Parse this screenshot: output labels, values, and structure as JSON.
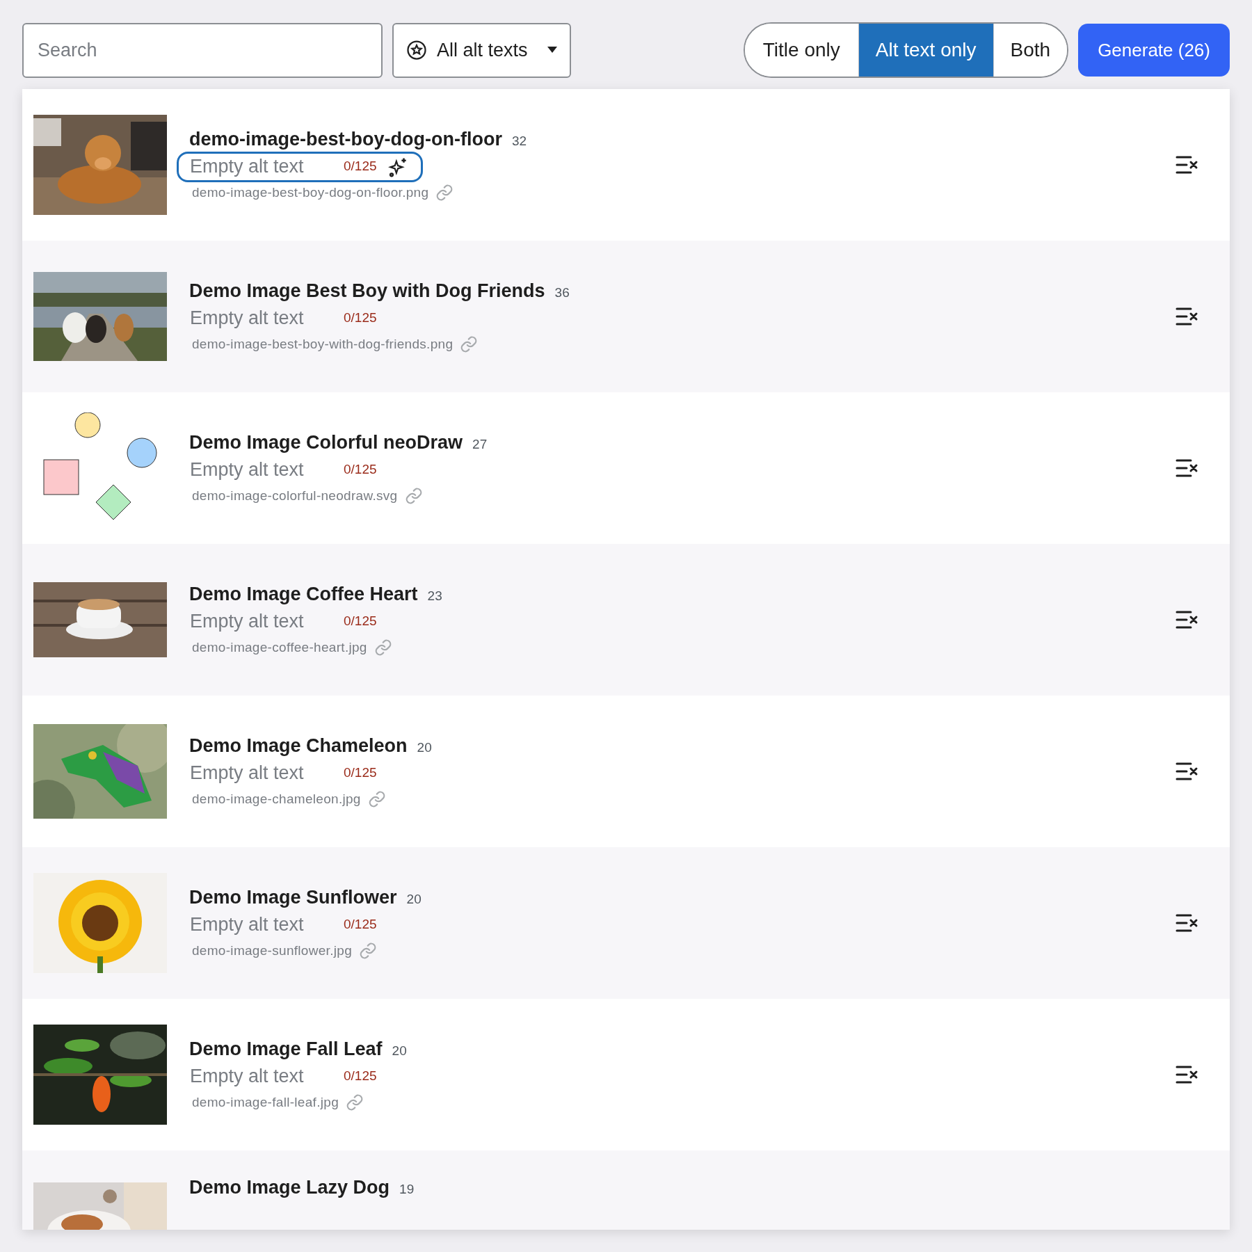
{
  "toolbar": {
    "search": {
      "placeholder": "Search"
    },
    "filter": {
      "label": "All alt texts"
    },
    "modes": [
      {
        "label": "Title only",
        "selected": false
      },
      {
        "label": "Alt text only",
        "selected": true
      },
      {
        "label": "Both",
        "selected": false
      }
    ],
    "generate": {
      "label": "Generate (26)"
    }
  },
  "images": [
    {
      "title": "demo-image-best-boy-dog-on-floor",
      "count": "32",
      "alt_placeholder": "Empty alt text",
      "limit": "0/125",
      "file": "demo-image-best-boy-dog-on-floor.png",
      "focused": true
    },
    {
      "title": "Demo Image Best Boy with Dog Friends",
      "count": "36",
      "alt_placeholder": "Empty alt text",
      "limit": "0/125",
      "file": "demo-image-best-boy-with-dog-friends.png",
      "focused": false
    },
    {
      "title": "Demo Image Colorful neoDraw",
      "count": "27",
      "alt_placeholder": "Empty alt text",
      "limit": "0/125",
      "file": "demo-image-colorful-neodraw.svg",
      "focused": false,
      "thumb": {
        "kind": "drawing"
      }
    },
    {
      "title": "Demo Image Coffee Heart",
      "count": "23",
      "alt_placeholder": "Empty alt text",
      "limit": "0/125",
      "file": "demo-image-coffee-heart.jpg",
      "focused": false
    },
    {
      "title": "Demo Image Chameleon",
      "count": "20",
      "alt_placeholder": "Empty alt text",
      "limit": "0/125",
      "file": "demo-image-chameleon.jpg",
      "focused": false
    },
    {
      "title": "Demo Image Sunflower",
      "count": "20",
      "alt_placeholder": "Empty alt text",
      "limit": "0/125",
      "file": "demo-image-sunflower.jpg",
      "focused": false
    },
    {
      "title": "Demo Image Fall Leaf",
      "count": "20",
      "alt_placeholder": "Empty alt text",
      "limit": "0/125",
      "file": "demo-image-fall-leaf.jpg",
      "focused": false
    },
    {
      "title": "Demo Image Lazy Dog",
      "count": "19"
    }
  ]
}
